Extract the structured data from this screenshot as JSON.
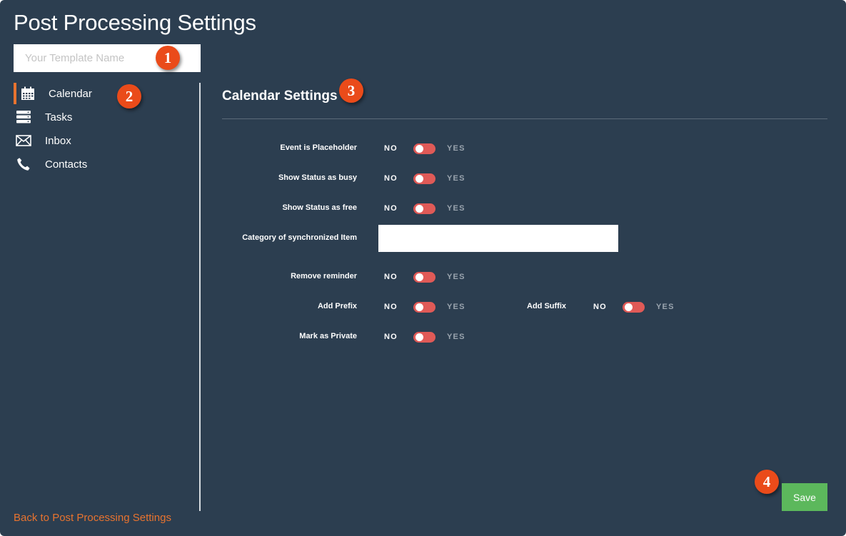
{
  "page": {
    "title": "Post Processing Settings"
  },
  "template": {
    "placeholder": "Your Template Name",
    "value": ""
  },
  "badges": [
    "1",
    "2",
    "3",
    "4"
  ],
  "sidebar": {
    "items": [
      {
        "label": "Calendar",
        "icon": "calendar-icon",
        "active": true
      },
      {
        "label": "Tasks",
        "icon": "server-stack-icon",
        "active": false
      },
      {
        "label": "Inbox",
        "icon": "envelope-icon",
        "active": false
      },
      {
        "label": "Contacts",
        "icon": "phone-icon",
        "active": false
      }
    ],
    "back_link": "Back to Post Processing Settings"
  },
  "section": {
    "title": "Calendar Settings",
    "toggle_no": "NO",
    "toggle_yes": "YES",
    "fields": {
      "event_placeholder": {
        "label": "Event is Placeholder",
        "value": "NO"
      },
      "status_busy": {
        "label": "Show Status as busy",
        "value": "NO"
      },
      "status_free": {
        "label": "Show Status as free",
        "value": "NO"
      },
      "category": {
        "label": "Category of synchronized Item",
        "value": ""
      },
      "remove_reminder": {
        "label": "Remove reminder",
        "value": "NO"
      },
      "add_prefix": {
        "label": "Add Prefix",
        "value": "NO"
      },
      "add_suffix": {
        "label": "Add Suffix",
        "value": "NO"
      },
      "mark_private": {
        "label": "Mark as Private",
        "value": "NO"
      }
    }
  },
  "actions": {
    "save_label": "Save"
  },
  "colors": {
    "background": "#2c3e50",
    "accent_orange": "#e8732f",
    "badge": "#ea4b1a",
    "toggle_off": "#e05a57",
    "save": "#5cb85c"
  }
}
